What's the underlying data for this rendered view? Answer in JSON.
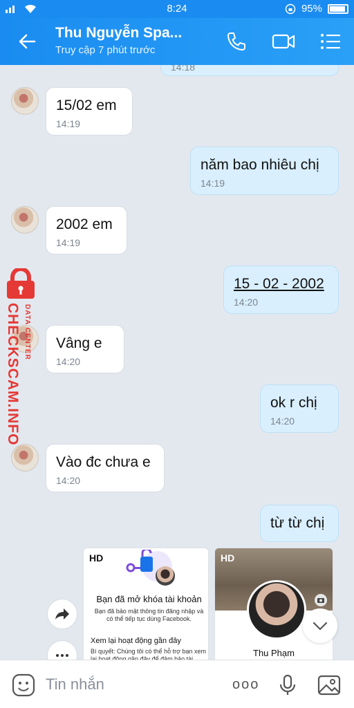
{
  "status_bar": {
    "time": "8:24",
    "battery": "95%"
  },
  "header": {
    "title": "Thu Nguyễn  Spa...",
    "subtitle": "Truy cập 7 phút trước"
  },
  "partial_top": {
    "time": "14:18"
  },
  "messages": [
    {
      "side": "in",
      "text": "15/02 em",
      "time": "14:19"
    },
    {
      "side": "out",
      "text": "năm bao nhiêu chị",
      "time": "14:19"
    },
    {
      "side": "in",
      "text": "2002 em",
      "time": "14:19"
    },
    {
      "side": "out",
      "text": "15 - 02 - 2002",
      "time": "14:20"
    },
    {
      "side": "in",
      "text": "Vâng e",
      "time": "14:20"
    },
    {
      "side": "out",
      "text": "ok r chị",
      "time": "14:20"
    },
    {
      "side": "in",
      "text": "Vào đc chưa e",
      "time": "14:20"
    },
    {
      "side": "out",
      "text": "từ từ chị",
      "time": ""
    }
  ],
  "watermark": {
    "brand": "CHECKSCAM.INFO",
    "subtitle": "DATA CENTER"
  },
  "images": [
    {
      "badge": "HD",
      "heading": "Bạn đã mở khóa tài khoản",
      "body": "Bạn đã bảo mật thông tin đăng nhập và có thể tiếp tục dùng Facebook.",
      "subheading": "Xem lại hoạt động gần đây",
      "tip": "Bí quyết: Chúng tôi có thể hỗ trợ bạn xem lại hoạt động gần đây để đảm bảo tài"
    },
    {
      "badge": "HD",
      "name": "Thu Phạm"
    }
  ],
  "input": {
    "placeholder": "Tin nhắn",
    "more": "ooo"
  },
  "colors": {
    "header": "#1a8cf1",
    "outgoing": "#d9effd",
    "incoming": "#ffffff",
    "watermark": "#e53935",
    "link": "#1a73d9"
  }
}
